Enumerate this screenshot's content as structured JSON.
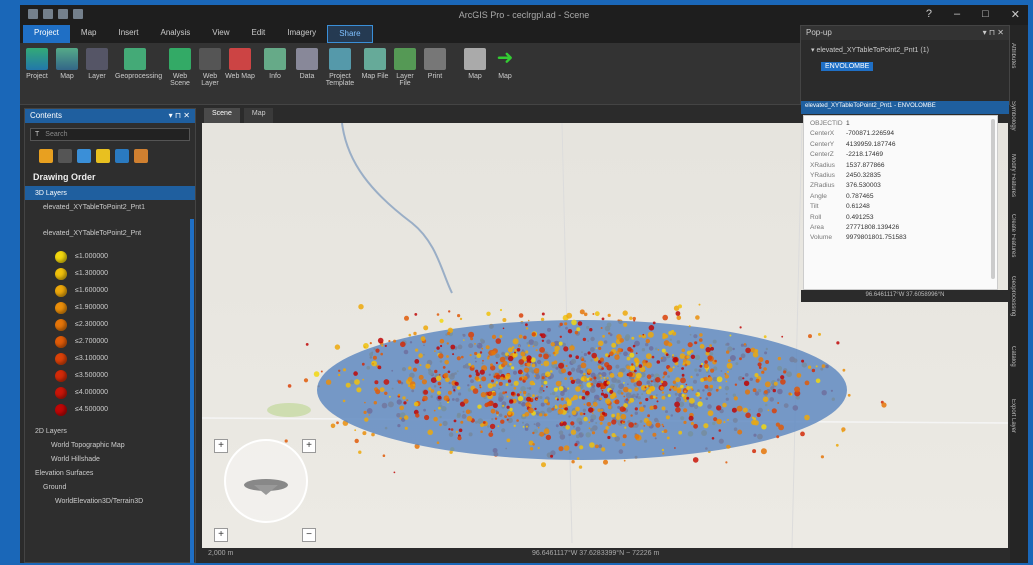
{
  "app": {
    "title": "ArcGIS Pro - ceclrgpl.ad - Scene"
  },
  "ribbon": {
    "tabs": [
      "Project",
      "Map",
      "Insert",
      "Analysis",
      "View",
      "Edit",
      "Imagery",
      "Share"
    ],
    "buttons": [
      "Project",
      "Map",
      "Layer",
      "Geoprocessing",
      "Web Scene",
      "Web Layer",
      "Web Map",
      "Info",
      "Data",
      "Project Template",
      "Map File",
      "Layer File",
      "Print",
      "Map",
      "Map"
    ]
  },
  "contents": {
    "title": "Contents",
    "search_placeholder": "Search",
    "drawing_order": "Drawing Order",
    "tree": {
      "layers_3d": "3D Layers",
      "layer_a": "elevated_XYTableToPoint2_Pnt1",
      "layer_b": "elevated_XYTableToPoint2_Pnt",
      "layers_2d": "2D Layers",
      "topo": "World Topographic Map",
      "hillshade": "World Hillshade",
      "elev": "Elevation Surfaces",
      "ground": "Ground",
      "terrain": "WorldElevation3D/Terrain3D"
    },
    "legend": [
      {
        "label": "≤1.000000",
        "color": "#f2d70e"
      },
      {
        "label": "≤1.300000",
        "color": "#f0c10c"
      },
      {
        "label": "≤1.600000",
        "color": "#eda80b"
      },
      {
        "label": "≤1.900000",
        "color": "#ea8e0a"
      },
      {
        "label": "≤2.300000",
        "color": "#e57509"
      },
      {
        "label": "≤2.700000",
        "color": "#e05b08"
      },
      {
        "label": "≤3.100000",
        "color": "#da4108"
      },
      {
        "label": "≤3.500000",
        "color": "#d22a08"
      },
      {
        "label": "≤4.000000",
        "color": "#c91508"
      },
      {
        "label": "≤4.500000",
        "color": "#bf0606"
      }
    ]
  },
  "map": {
    "tabs": [
      "Scene",
      "Map"
    ],
    "scale": "2,000 m",
    "coords": "96.6461117°W 37.6283399°N  ~  72226 m"
  },
  "popup": {
    "title": "Pop-up",
    "layer": "elevated_XYTableToPoint2_Pnt1 (1)",
    "feature": "ENVOLOMBE",
    "attr_header": "elevated_XYTableToPoint2_Pnt1 - ENVOLOMBE",
    "attributes": [
      {
        "k": "OBJECTID",
        "v": "1"
      },
      {
        "k": "CenterX",
        "v": "-700871.226594"
      },
      {
        "k": "CenterY",
        "v": "4139959.187746"
      },
      {
        "k": "CenterZ",
        "v": "-2218.17469"
      },
      {
        "k": "XRadius",
        "v": "1537.877866"
      },
      {
        "k": "YRadius",
        "v": "2450.32835"
      },
      {
        "k": "ZRadius",
        "v": "376.530003"
      },
      {
        "k": "Angle",
        "v": "0.787465"
      },
      {
        "k": "Tilt",
        "v": "0.61248"
      },
      {
        "k": "Roll",
        "v": "0.491253"
      },
      {
        "k": "Area",
        "v": "27771808.139426"
      },
      {
        "k": "Volume",
        "v": "9979801801.751583"
      }
    ],
    "footer": "96.6461117°W 37.6058996°N"
  },
  "right_dock": [
    "Attributes",
    "Symbology",
    "Modify Features",
    "Create Features",
    "Geoprocessing",
    "Catalog",
    "Export Layer"
  ]
}
